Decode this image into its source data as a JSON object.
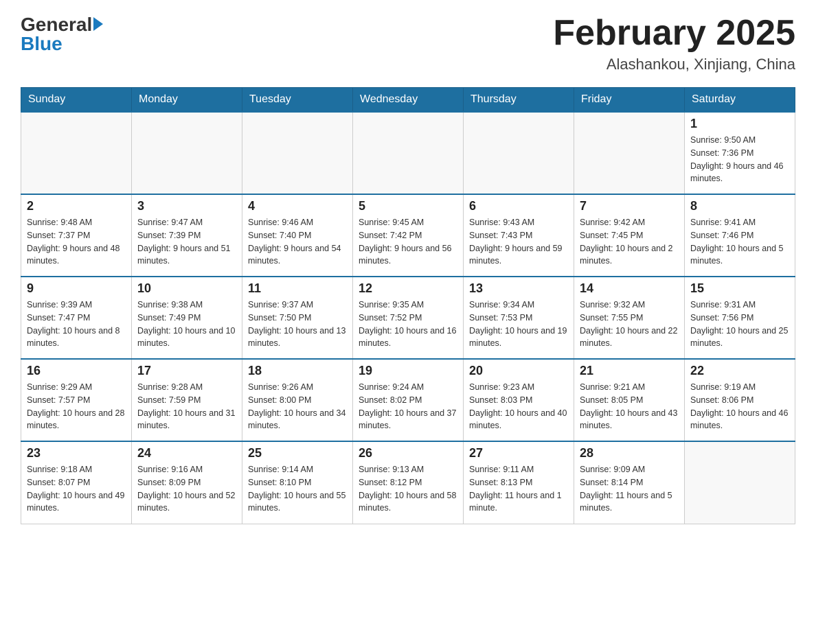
{
  "header": {
    "logo_general": "General",
    "logo_blue": "Blue",
    "month_title": "February 2025",
    "location": "Alashankou, Xinjiang, China"
  },
  "days_of_week": [
    "Sunday",
    "Monday",
    "Tuesday",
    "Wednesday",
    "Thursday",
    "Friday",
    "Saturday"
  ],
  "weeks": [
    [
      {
        "day": "",
        "info": ""
      },
      {
        "day": "",
        "info": ""
      },
      {
        "day": "",
        "info": ""
      },
      {
        "day": "",
        "info": ""
      },
      {
        "day": "",
        "info": ""
      },
      {
        "day": "",
        "info": ""
      },
      {
        "day": "1",
        "info": "Sunrise: 9:50 AM\nSunset: 7:36 PM\nDaylight: 9 hours and 46 minutes."
      }
    ],
    [
      {
        "day": "2",
        "info": "Sunrise: 9:48 AM\nSunset: 7:37 PM\nDaylight: 9 hours and 48 minutes."
      },
      {
        "day": "3",
        "info": "Sunrise: 9:47 AM\nSunset: 7:39 PM\nDaylight: 9 hours and 51 minutes."
      },
      {
        "day": "4",
        "info": "Sunrise: 9:46 AM\nSunset: 7:40 PM\nDaylight: 9 hours and 54 minutes."
      },
      {
        "day": "5",
        "info": "Sunrise: 9:45 AM\nSunset: 7:42 PM\nDaylight: 9 hours and 56 minutes."
      },
      {
        "day": "6",
        "info": "Sunrise: 9:43 AM\nSunset: 7:43 PM\nDaylight: 9 hours and 59 minutes."
      },
      {
        "day": "7",
        "info": "Sunrise: 9:42 AM\nSunset: 7:45 PM\nDaylight: 10 hours and 2 minutes."
      },
      {
        "day": "8",
        "info": "Sunrise: 9:41 AM\nSunset: 7:46 PM\nDaylight: 10 hours and 5 minutes."
      }
    ],
    [
      {
        "day": "9",
        "info": "Sunrise: 9:39 AM\nSunset: 7:47 PM\nDaylight: 10 hours and 8 minutes."
      },
      {
        "day": "10",
        "info": "Sunrise: 9:38 AM\nSunset: 7:49 PM\nDaylight: 10 hours and 10 minutes."
      },
      {
        "day": "11",
        "info": "Sunrise: 9:37 AM\nSunset: 7:50 PM\nDaylight: 10 hours and 13 minutes."
      },
      {
        "day": "12",
        "info": "Sunrise: 9:35 AM\nSunset: 7:52 PM\nDaylight: 10 hours and 16 minutes."
      },
      {
        "day": "13",
        "info": "Sunrise: 9:34 AM\nSunset: 7:53 PM\nDaylight: 10 hours and 19 minutes."
      },
      {
        "day": "14",
        "info": "Sunrise: 9:32 AM\nSunset: 7:55 PM\nDaylight: 10 hours and 22 minutes."
      },
      {
        "day": "15",
        "info": "Sunrise: 9:31 AM\nSunset: 7:56 PM\nDaylight: 10 hours and 25 minutes."
      }
    ],
    [
      {
        "day": "16",
        "info": "Sunrise: 9:29 AM\nSunset: 7:57 PM\nDaylight: 10 hours and 28 minutes."
      },
      {
        "day": "17",
        "info": "Sunrise: 9:28 AM\nSunset: 7:59 PM\nDaylight: 10 hours and 31 minutes."
      },
      {
        "day": "18",
        "info": "Sunrise: 9:26 AM\nSunset: 8:00 PM\nDaylight: 10 hours and 34 minutes."
      },
      {
        "day": "19",
        "info": "Sunrise: 9:24 AM\nSunset: 8:02 PM\nDaylight: 10 hours and 37 minutes."
      },
      {
        "day": "20",
        "info": "Sunrise: 9:23 AM\nSunset: 8:03 PM\nDaylight: 10 hours and 40 minutes."
      },
      {
        "day": "21",
        "info": "Sunrise: 9:21 AM\nSunset: 8:05 PM\nDaylight: 10 hours and 43 minutes."
      },
      {
        "day": "22",
        "info": "Sunrise: 9:19 AM\nSunset: 8:06 PM\nDaylight: 10 hours and 46 minutes."
      }
    ],
    [
      {
        "day": "23",
        "info": "Sunrise: 9:18 AM\nSunset: 8:07 PM\nDaylight: 10 hours and 49 minutes."
      },
      {
        "day": "24",
        "info": "Sunrise: 9:16 AM\nSunset: 8:09 PM\nDaylight: 10 hours and 52 minutes."
      },
      {
        "day": "25",
        "info": "Sunrise: 9:14 AM\nSunset: 8:10 PM\nDaylight: 10 hours and 55 minutes."
      },
      {
        "day": "26",
        "info": "Sunrise: 9:13 AM\nSunset: 8:12 PM\nDaylight: 10 hours and 58 minutes."
      },
      {
        "day": "27",
        "info": "Sunrise: 9:11 AM\nSunset: 8:13 PM\nDaylight: 11 hours and 1 minute."
      },
      {
        "day": "28",
        "info": "Sunrise: 9:09 AM\nSunset: 8:14 PM\nDaylight: 11 hours and 5 minutes."
      },
      {
        "day": "",
        "info": ""
      }
    ]
  ]
}
